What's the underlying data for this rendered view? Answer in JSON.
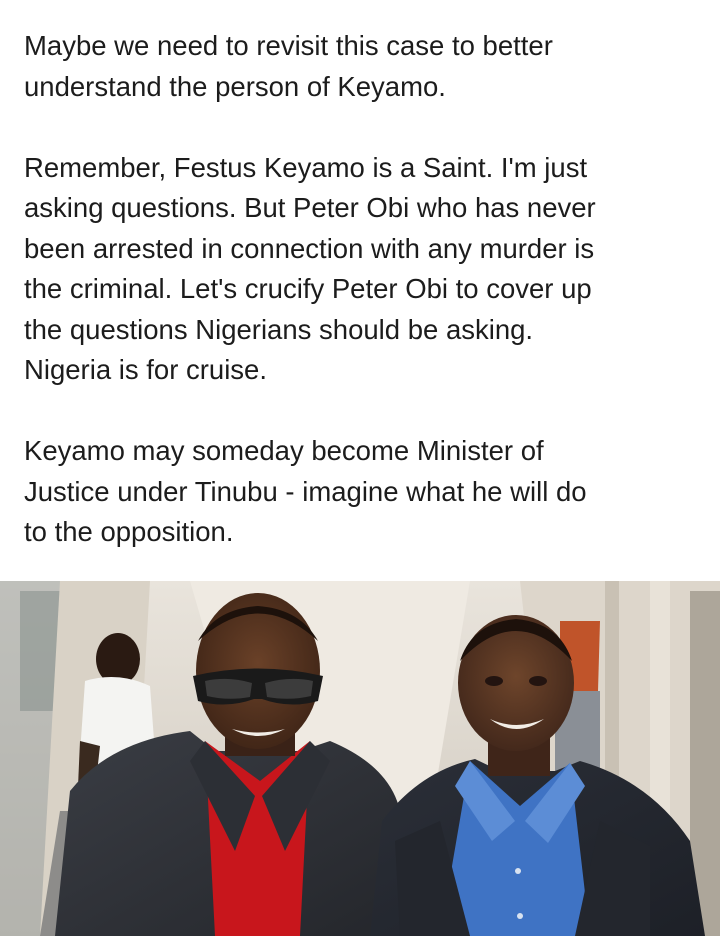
{
  "post": {
    "paragraphs": [
      {
        "lines": [
          "Maybe we need to revisit this case to better",
          "understand the person of Keyamo."
        ]
      },
      {
        "lines": [
          "Remember, Festus Keyamo is a Saint. I'm just",
          "asking questions. But Peter Obi who has never",
          "been arrested in connection with any murder is",
          "the criminal. Let's crucify Peter Obi to cover up",
          "the questions Nigerians should be asking.",
          "Nigeria is for cruise."
        ]
      },
      {
        "lines": [
          "Keyamo may someday become Minister of",
          "Justice under Tinubu - imagine what he will do",
          "to the opposition."
        ]
      }
    ]
  },
  "colors": {
    "text": "#1c1c1c",
    "background": "#ffffff",
    "red_shirt": "#c8161c",
    "blue_shirt": "#3f73c4",
    "suit": "#2f3238"
  }
}
